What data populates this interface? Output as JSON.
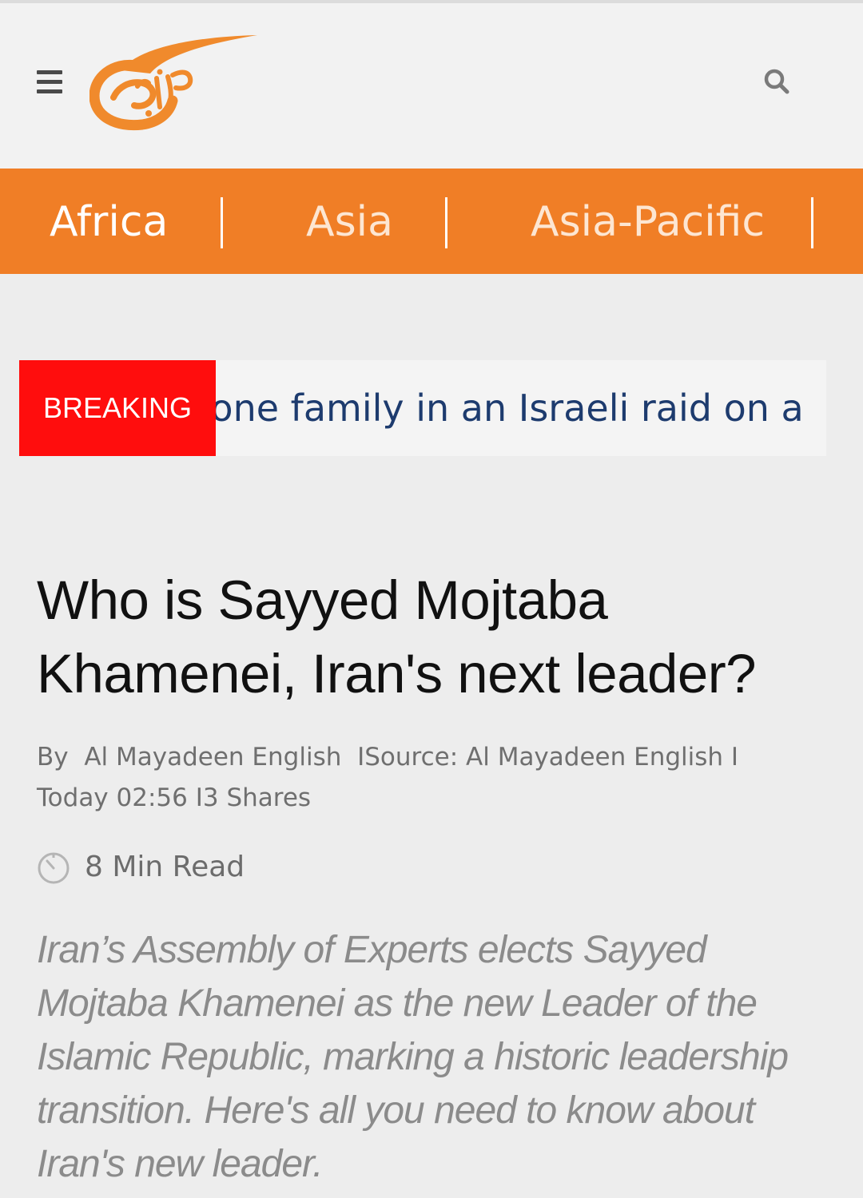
{
  "header": {
    "menu_icon": "hamburger-menu-icon",
    "logo_icon": "al-mayadeen-logo",
    "search_icon": "search-icon"
  },
  "nav": {
    "items": [
      "Africa",
      "Asia",
      "Asia-Pacific"
    ]
  },
  "breaking": {
    "label": "BREAKING",
    "ticker_text": "m one family in an Israeli raid on a"
  },
  "article": {
    "title": "Who is Sayyed Mojtaba Khamenei, Iran's next leader?",
    "by_label": "By",
    "author": "Al Mayadeen English",
    "source_label": "Source: Al Mayadeen English",
    "date": "Today 02:56",
    "shares": "3 Shares",
    "separator": "I",
    "read_time": "8 Min Read",
    "read_time_icon": "clock-icon",
    "lead": "Iran’s Assembly of Experts elects Sayyed Mojtaba Khamenei as the new Leader of the Islamic Republic, marking a historic leadership transition. Here's all you need to know about Iran's new leader."
  },
  "colors": {
    "nav_bg": "#f07e26",
    "breaking_red": "#ff0d0d",
    "ticker_text": "#1d3b6e",
    "logo_orange": "#f08a2c"
  }
}
